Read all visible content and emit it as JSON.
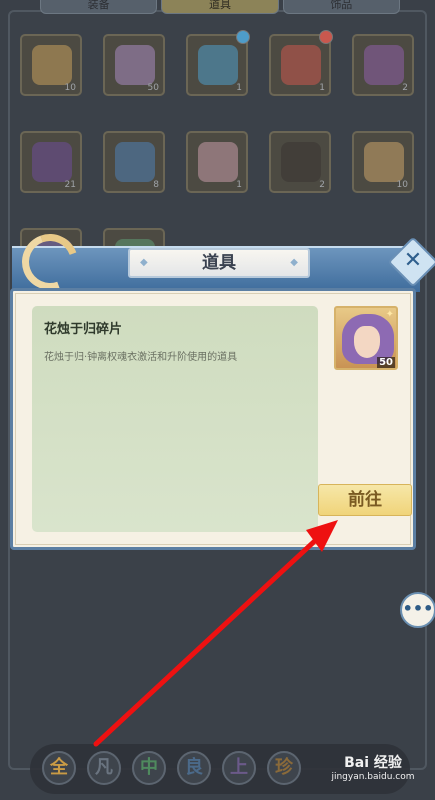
{
  "tabs": [
    {
      "label": "装备",
      "active": false
    },
    {
      "label": "道具",
      "active": true
    },
    {
      "label": "饰品",
      "active": false
    }
  ],
  "inventory": [
    {
      "icon": "scroll-icon",
      "count": "10",
      "color": "#c59f5c"
    },
    {
      "icon": "character-portrait-icon",
      "count": "50",
      "color": "#a88bc0"
    },
    {
      "icon": "blue-orb-icon",
      "count": "1",
      "color": "#4e9cc9"
    },
    {
      "icon": "red-orb-icon",
      "count": "1",
      "color": "#c9584e"
    },
    {
      "icon": "grape-icon",
      "count": "2",
      "color": "#8e5fa8"
    },
    {
      "icon": "purple-crystal-icon",
      "count": "21",
      "color": "#6d4d99"
    },
    {
      "icon": "blue-card-icon",
      "count": "8",
      "color": "#4f7fb5"
    },
    {
      "icon": "pink-card-icon",
      "count": "1",
      "color": "#c49aa7"
    },
    {
      "icon": "black-feather-icon",
      "count": "2",
      "color": "#3b3533"
    },
    {
      "icon": "old-map-icon",
      "count": "10",
      "color": "#c9a36a"
    },
    {
      "icon": "purple-item-icon",
      "count": "",
      "color": "#7a6bb6"
    },
    {
      "icon": "green-item-icon",
      "count": "",
      "color": "#5f9b74"
    }
  ],
  "filters": [
    {
      "label": "全",
      "color": "#c99b45"
    },
    {
      "label": "凡",
      "color": "#6a7480"
    },
    {
      "label": "中",
      "color": "#4f8a5e"
    },
    {
      "label": "良",
      "color": "#4b6a8a"
    },
    {
      "label": "上",
      "color": "#6b5a8a"
    },
    {
      "label": "珍",
      "color": "#8a6a3a"
    }
  ],
  "dialog": {
    "title": "道具",
    "item_name": "花烛于归碎片",
    "item_description": "花烛于归·钟离权魂衣激活和升阶使用的道具",
    "portrait_level": "50",
    "go_button_label": "前往",
    "close_icon": "close-icon"
  },
  "chat_button_label": "•••",
  "watermark": {
    "line1": "Bai 经验",
    "line2": "jingyan.baidu.com"
  },
  "colors": {
    "annotation_arrow": "#ee1111",
    "header_blue": "#3e6c9c",
    "go_button": "#f0d47a"
  }
}
